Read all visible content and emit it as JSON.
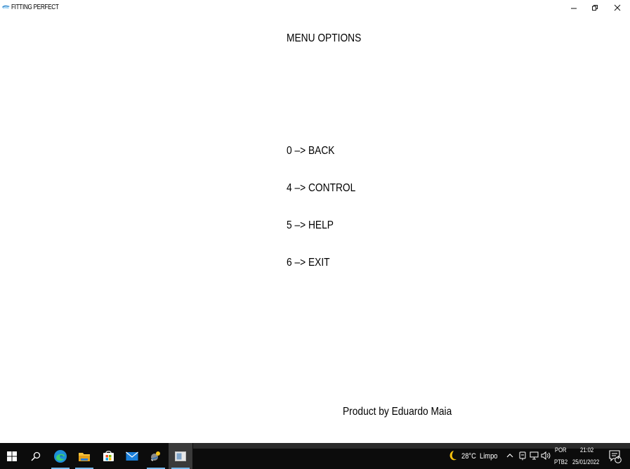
{
  "window": {
    "title": "FITTING PERFECT",
    "minimize_glyph": "–",
    "restore_glyph": "❐",
    "close_glyph": "X"
  },
  "main": {
    "title": "MENU OPTIONS",
    "items": [
      {
        "label": "0 –> BACK"
      },
      {
        "label": "4 –> CONTROL"
      },
      {
        "label": "5 –> HELP"
      },
      {
        "label": "6 –> EXIT"
      }
    ],
    "footer": "Product by Eduardo Maia"
  },
  "taskbar": {
    "apps": [
      {
        "name": "windows-start-icon"
      },
      {
        "name": "search-icon"
      },
      {
        "name": "edge-browser-icon"
      },
      {
        "name": "file-explorer-icon"
      },
      {
        "name": "microsoft-store-icon"
      },
      {
        "name": "mail-icon"
      },
      {
        "name": "python-app-icon"
      },
      {
        "name": "active-window-icon"
      }
    ],
    "weather": {
      "temperature": "28°C",
      "condition": "Limpo",
      "icon": "moon-icon"
    },
    "language": {
      "line1": "POR",
      "line2": "PTB2"
    },
    "clock": {
      "time": "21:02",
      "date": "25/01/2022"
    },
    "notifications": {
      "count": "4"
    },
    "colors": {
      "background": "#0c0c0c",
      "accent_underline": "#76b9ed"
    }
  }
}
